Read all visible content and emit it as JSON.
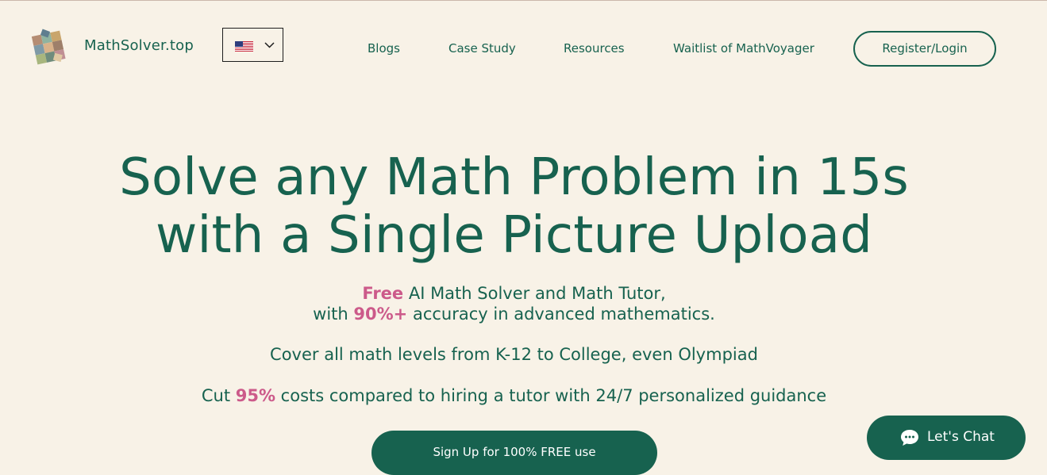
{
  "header": {
    "brand": "MathSolver.top",
    "language": {
      "selected": "English (US)",
      "flag_icon": "us-flag-icon"
    },
    "nav": [
      {
        "label": "Blogs"
      },
      {
        "label": "Case Study"
      },
      {
        "label": "Resources"
      },
      {
        "label": "Waitlist of MathVoyager"
      }
    ],
    "register_label": "Register/Login"
  },
  "hero": {
    "title_line1": "Solve any Math Problem in 15s",
    "title_line2": "with a Single Picture Upload",
    "line1_em": "Free",
    "line1_rest": " AI Math Solver and Math Tutor,",
    "line2_pre": "with ",
    "line2_em": "90%+",
    "line2_rest": " accuracy in advanced mathematics.",
    "line3": "Cover all math levels from K-12 to College, even Olympiad",
    "line4_pre": "Cut ",
    "line4_em": "95%",
    "line4_rest": " costs compared to hiring a tutor with 24/7 personalized guidance",
    "cta_label": "Sign Up for 100% FREE use"
  },
  "chat": {
    "label": "Let's Chat",
    "icon": "chat-bubble-icon"
  },
  "colors": {
    "background": "#f8f2e7",
    "primary": "#17624f",
    "accent": "#cc5a8a"
  }
}
